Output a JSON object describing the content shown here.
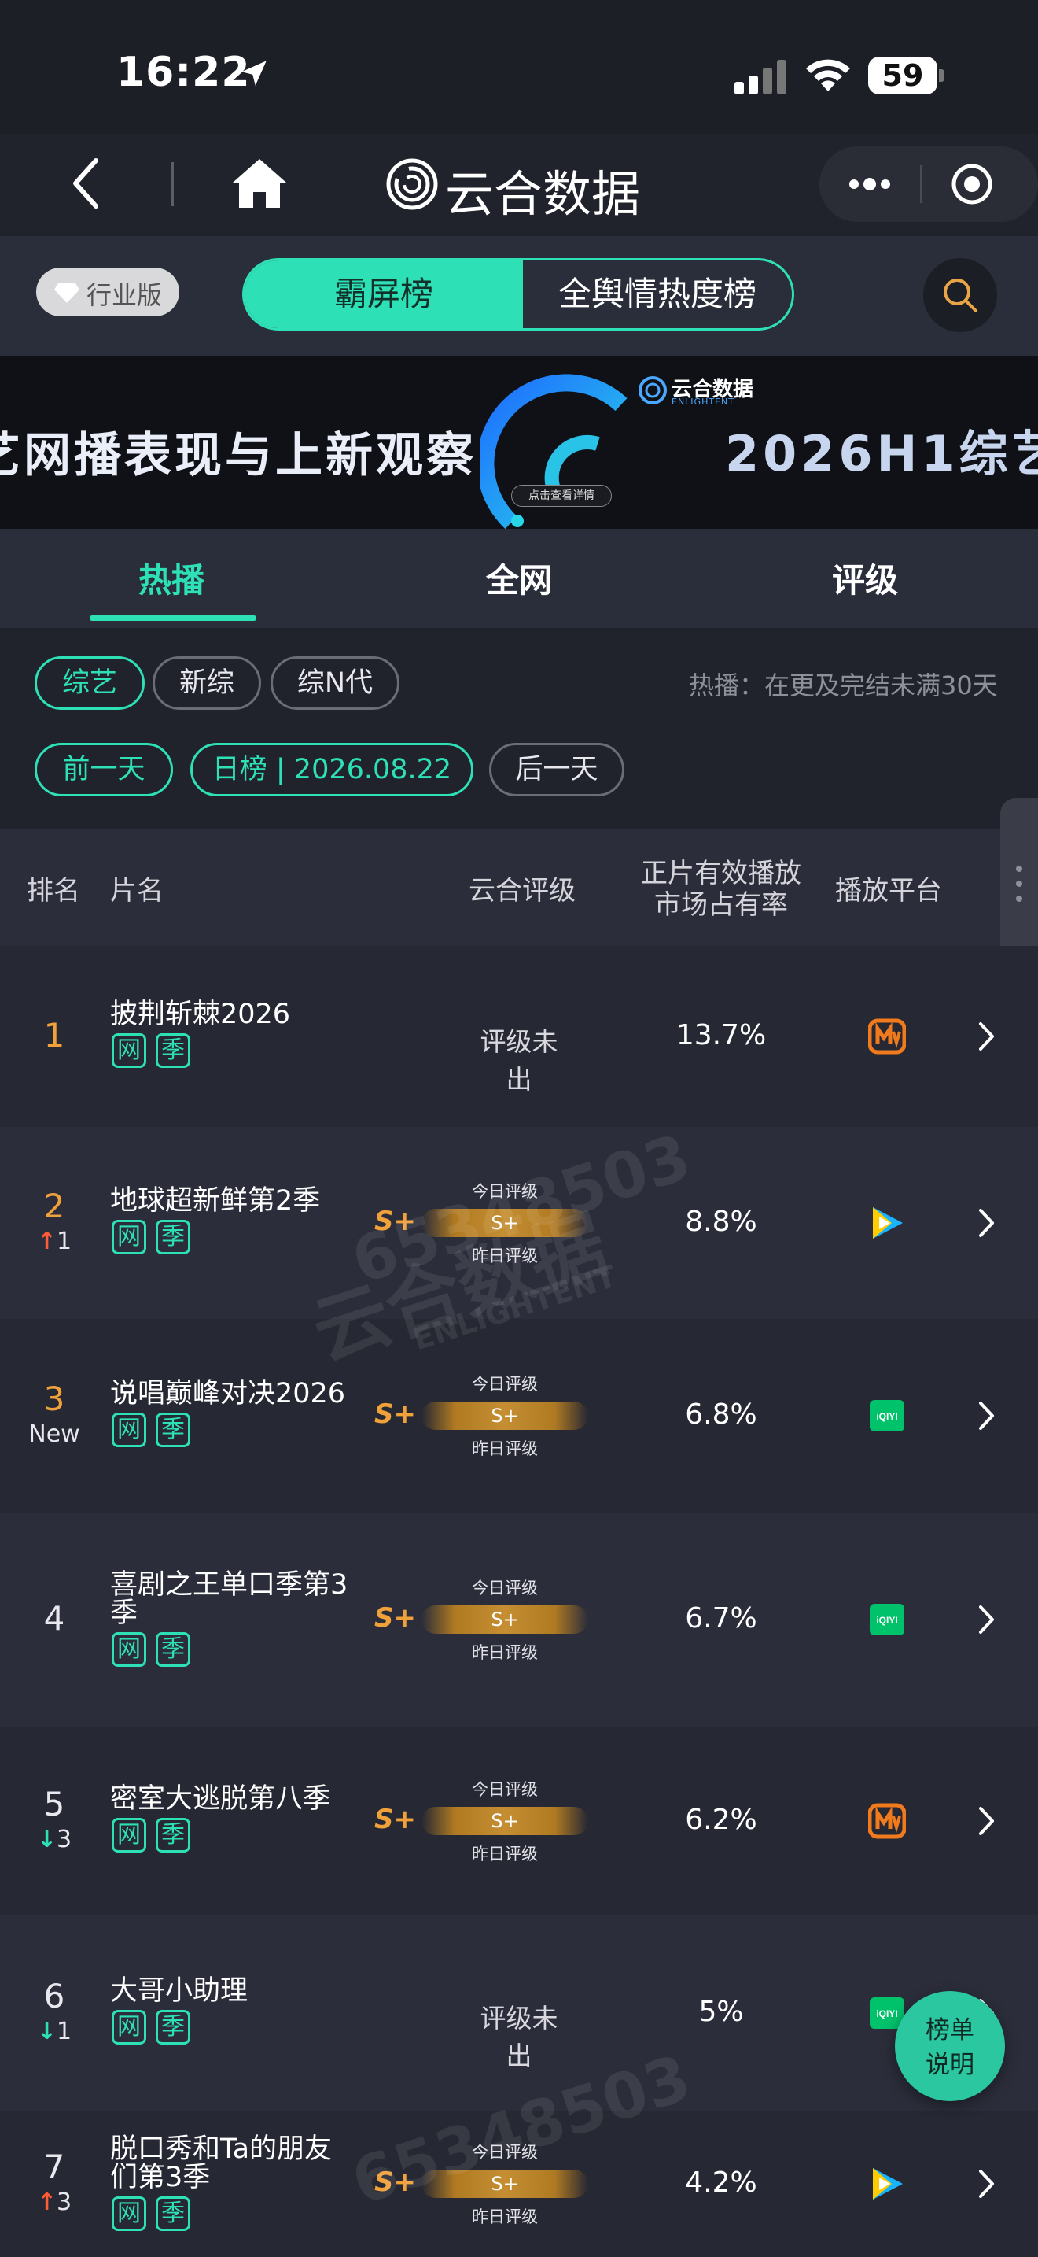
{
  "status_bar": {
    "time": "16:22",
    "battery": "59"
  },
  "nav": {
    "title": "云合数据"
  },
  "toolbar": {
    "industry_label": "行业版",
    "segments": [
      "霸屏榜",
      "全舆情热度榜"
    ]
  },
  "banner": {
    "left_text": "艺网播表现与上新观察",
    "right_text": "2026H1综艺",
    "logo_text": "云合数据",
    "logo_sub": "ENLIGHTENT",
    "cta": "点击查看详情"
  },
  "tabs": [
    "热播",
    "全网",
    "评级"
  ],
  "filters": {
    "categories": [
      "综艺",
      "新综",
      "综N代"
    ],
    "hint": "热播：在更及完结未满30天",
    "date_prev": "前一天",
    "date_current": "日榜 | 2026.08.22",
    "date_next": "后一天"
  },
  "table": {
    "headers": {
      "rank": "排名",
      "name": "片名",
      "grade": "云合评级",
      "share_line1": "正片有效播放",
      "share_line2": "市场占有率",
      "platform": "播放平台"
    },
    "rows": [
      {
        "rank": "1",
        "change": "",
        "change_dir": "",
        "title_line1": "披荆斩棘2026",
        "title_line2": "",
        "grade_text": "评级未出",
        "grade_left": "",
        "grade_today": "",
        "share": "13.7%",
        "platform": "mango-tv-icon"
      },
      {
        "rank": "2",
        "change": "1",
        "change_dir": "up",
        "title_line1": "地球超新鲜第2季",
        "title_line2": "",
        "grade_text": "",
        "grade_left": "S+",
        "grade_today": "S+",
        "share": "8.8%",
        "platform": "tencent-video-icon"
      },
      {
        "rank": "3",
        "change": "New",
        "change_dir": "new",
        "title_line1": "说唱巅峰对决2026",
        "title_line2": "",
        "grade_text": "",
        "grade_left": "S+",
        "grade_today": "S+",
        "share": "6.8%",
        "platform": "iqiyi-icon"
      },
      {
        "rank": "4",
        "change": "",
        "change_dir": "",
        "title_line1": "喜剧之王单口季第3",
        "title_line2": "季",
        "grade_text": "",
        "grade_left": "S+",
        "grade_today": "S+",
        "share": "6.7%",
        "platform": "iqiyi-icon"
      },
      {
        "rank": "5",
        "change": "3",
        "change_dir": "down",
        "title_line1": "密室大逃脱第八季",
        "title_line2": "",
        "grade_text": "",
        "grade_left": "S+",
        "grade_today": "S+",
        "share": "6.2%",
        "platform": "mango-tv-icon"
      },
      {
        "rank": "6",
        "change": "1",
        "change_dir": "down",
        "title_line1": "大哥小助理",
        "title_line2": "",
        "grade_text": "评级未出",
        "grade_left": "",
        "grade_today": "",
        "share": "5%",
        "platform": "iqiyi-icon"
      },
      {
        "rank": "7",
        "change": "3",
        "change_dir": "up",
        "title_line1": "脱口秀和Ta的朋友",
        "title_line2": "们第3季",
        "grade_text": "",
        "grade_left": "S+",
        "grade_today": "S+",
        "share": "4.2%",
        "platform": "tencent-video-icon"
      }
    ],
    "tag_net": "网",
    "tag_season": "季",
    "grade_today_caption": "今日评级",
    "grade_yesterday_caption": "昨日评级"
  },
  "watermark": {
    "id": "65348503",
    "logo": "云合数据",
    "logo_sub": "ENLIGHTENT"
  },
  "float_button": {
    "line1": "榜单",
    "line2": "说明"
  },
  "colors": {
    "accent": "#2ee0b6",
    "gold": "#f0a13a",
    "up": "#ff5b37",
    "down": "#2ee0b6",
    "background": "#21232c"
  }
}
